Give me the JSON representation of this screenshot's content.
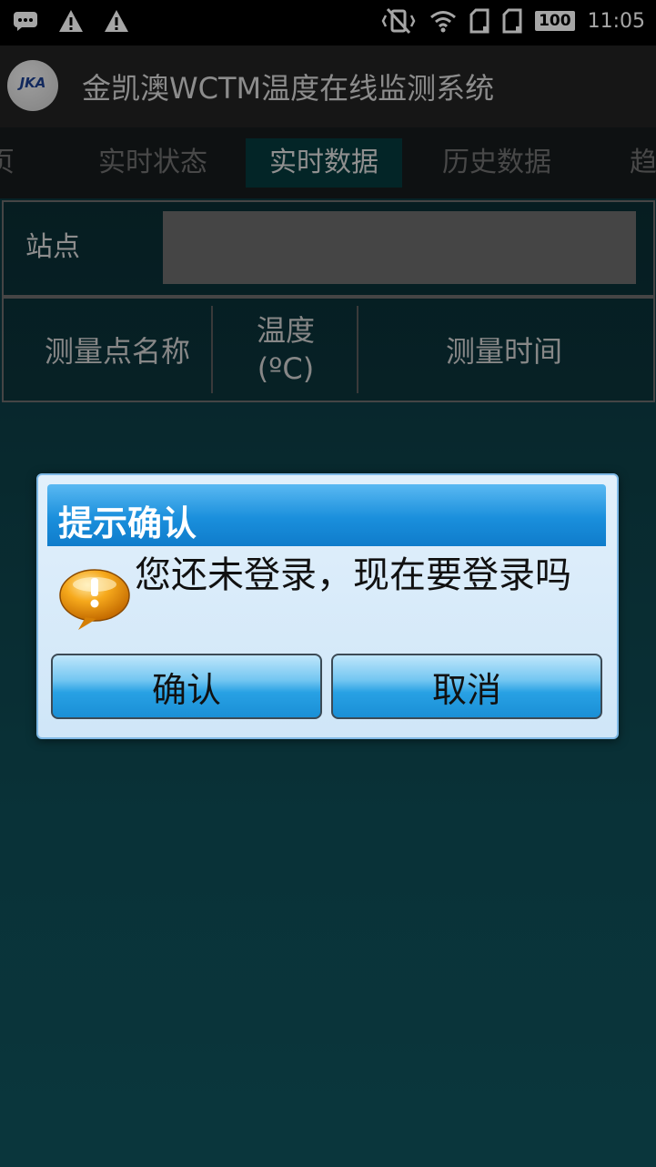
{
  "status_bar": {
    "icons_left": [
      "message-icon",
      "warning-icon",
      "warning-icon"
    ],
    "icons_right": [
      "vibrate-off-icon",
      "wifi-icon",
      "sim1-icon",
      "sim2-icon"
    ],
    "battery": "100",
    "time": "11:05"
  },
  "app": {
    "logo_text": "JKA",
    "title": "金凯澳WCTM温度在线监测系统"
  },
  "tabs": [
    {
      "label": "页"
    },
    {
      "label": "实时状态"
    },
    {
      "label": "实时数据",
      "active": true
    },
    {
      "label": "历史数据"
    },
    {
      "label": "趋"
    }
  ],
  "site": {
    "label": "站点",
    "value": ""
  },
  "table": {
    "headers": [
      "测量点名称",
      "温度\n(ºC)",
      "测量时间"
    ]
  },
  "dialog": {
    "title": "提示确认",
    "message": "您还未登录，现在要登录吗",
    "confirm_label": "确认",
    "cancel_label": "取消"
  },
  "colors": {
    "dialog_header": "#1a8fdc",
    "button": "#28a1e4",
    "background": "#0f4a52"
  }
}
